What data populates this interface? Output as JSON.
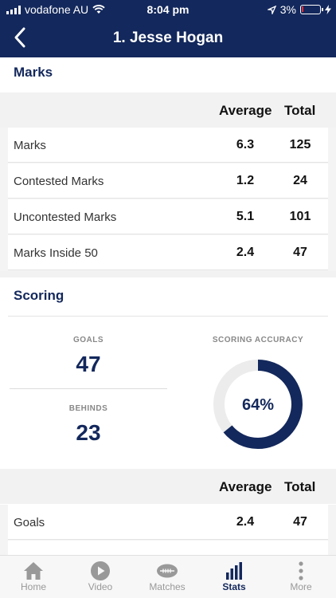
{
  "status_bar": {
    "carrier": "vodafone AU",
    "time": "8:04 pm",
    "battery": "3%",
    "battery_fraction": 0.03
  },
  "nav": {
    "title": "1. Jesse Hogan"
  },
  "marks": {
    "heading": "Marks",
    "col_avg": "Average",
    "col_total": "Total",
    "rows": [
      {
        "label": "Marks",
        "avg": "6.3",
        "total": "125"
      },
      {
        "label": "Contested Marks",
        "avg": "1.2",
        "total": "24"
      },
      {
        "label": "Uncontested Marks",
        "avg": "5.1",
        "total": "101"
      },
      {
        "label": "Marks Inside 50",
        "avg": "2.4",
        "total": "47"
      }
    ]
  },
  "scoring": {
    "heading": "Scoring",
    "goals_label": "GOALS",
    "goals_value": "47",
    "behinds_label": "BEHINDS",
    "behinds_value": "23",
    "accuracy_label": "SCORING ACCURACY",
    "accuracy_value": "64%",
    "accuracy_fraction": 0.64,
    "col_avg": "Average",
    "col_total": "Total",
    "rows": [
      {
        "label": "Goals",
        "avg": "2.4",
        "total": "47"
      }
    ]
  },
  "tabs": [
    {
      "label": "Home",
      "icon": "home-icon"
    },
    {
      "label": "Video",
      "icon": "play-icon"
    },
    {
      "label": "Matches",
      "icon": "football-icon"
    },
    {
      "label": "Stats",
      "icon": "bar-chart-icon",
      "active": true
    },
    {
      "label": "More",
      "icon": "more-vertical-icon"
    }
  ],
  "colors": {
    "brand": "#13285c",
    "ring_track": "#ececec",
    "battery_low": "#e0303a"
  }
}
